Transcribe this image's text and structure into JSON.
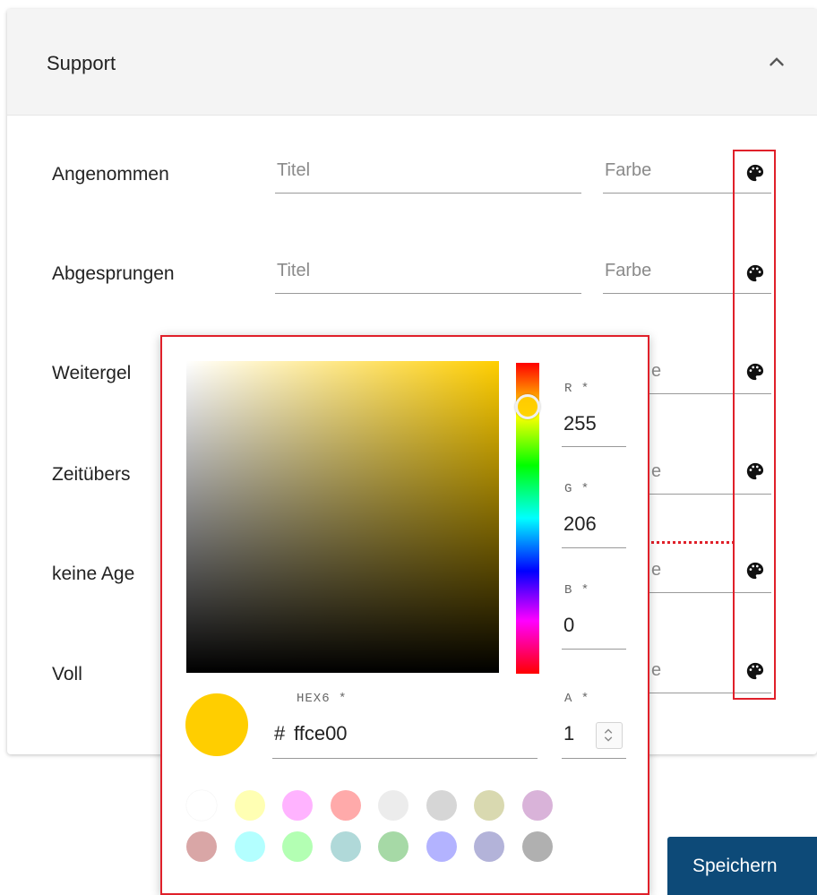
{
  "panel": {
    "title": "Support"
  },
  "rows": [
    {
      "label": "Angenommen",
      "title_placeholder": "Titel",
      "color_placeholder": "Farbe"
    },
    {
      "label": "Abgesprungen",
      "title_placeholder": "Titel",
      "color_placeholder": "Farbe"
    },
    {
      "label": "Weitergel",
      "color_placeholder_partial": "e"
    },
    {
      "label": "Zeitübers",
      "color_placeholder_partial": "e"
    },
    {
      "label": "keine Age",
      "color_placeholder_partial": "e"
    },
    {
      "label": "Voll",
      "color_placeholder_partial": "e"
    }
  ],
  "picker": {
    "r_label": "R *",
    "r_value": "255",
    "g_label": "G *",
    "g_value": "206",
    "b_label": "B *",
    "b_value": "0",
    "hex_label": "HEX6 *",
    "hex_prefix": "#",
    "hex_value": "ffce00",
    "a_label": "A *",
    "a_value": "1",
    "selected_color": "#ffce00",
    "swatches_row1": [
      "#ffffff",
      "#ffffb3",
      "#ffb3ff",
      "#ffaaaa",
      "#ececec",
      "#d6d6d6",
      "#d9d9b0",
      "#d9b3d9"
    ],
    "swatches_row2": [
      "#d9a6a6",
      "#b3ffff",
      "#b3ffb3",
      "#b0d9d9",
      "#a6d9a6",
      "#b3b3ff",
      "#b3b3d9",
      "#b0b0b0"
    ]
  },
  "actions": {
    "save_label": "Speichern"
  },
  "colors": {
    "accent": "#0d4a78",
    "highlight": "#e0202a"
  },
  "icons": {
    "collapse": "chevron-up-icon",
    "palette": "palette-icon"
  }
}
